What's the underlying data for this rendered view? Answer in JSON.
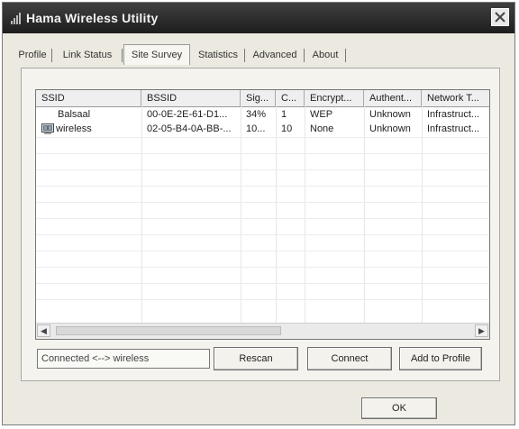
{
  "window": {
    "title": "Hama Wireless Utility"
  },
  "tabs": [
    {
      "label": "Profile"
    },
    {
      "label": "Link Status"
    },
    {
      "label": "Site Survey",
      "active": true
    },
    {
      "label": "Statistics"
    },
    {
      "label": "Advanced"
    },
    {
      "label": "About"
    }
  ],
  "table": {
    "columns": [
      "SSID",
      "BSSID",
      "Sig...",
      "C...",
      "Encrypt...",
      "Authent...",
      "Network T..."
    ],
    "rows": [
      {
        "ssid": "Balsaal",
        "bssid": "00-0E-2E-61-D1...",
        "signal": "34%",
        "channel": "1",
        "encryption": "WEP",
        "auth": "Unknown",
        "network_type": "Infrastruct...",
        "connected": false
      },
      {
        "ssid": "wireless",
        "bssid": "02-05-B4-0A-BB-...",
        "signal": "10...",
        "channel": "10",
        "encryption": "None",
        "auth": "Unknown",
        "network_type": "Infrastruct...",
        "connected": true
      }
    ]
  },
  "status_text": "Connected <--> wireless",
  "buttons": {
    "rescan": "Rescan",
    "connect": "Connect",
    "add_to_profile": "Add to Profile",
    "ok": "OK"
  },
  "icons": {
    "close": "close-icon",
    "signal": "signal-icon",
    "connected": "connected-network-icon",
    "scroll_left": "chevron-left-icon",
    "scroll_right": "chevron-right-icon"
  },
  "colors": {
    "titlebar": "#2b2b2b",
    "dialog_bg": "#ece9e0"
  }
}
